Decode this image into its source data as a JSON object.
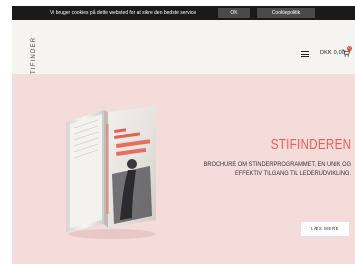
{
  "cookie_bar": {
    "text": "Vi bruger cookies på dette websted for at sikre den bedste service",
    "ok_label": "OK",
    "policy_label": "Cookiepolitik"
  },
  "header": {
    "logo_text": "STIFINDER",
    "cart_amount": "DKK 0,00",
    "cart_count": "0"
  },
  "hero": {
    "title": "STIFINDEREN",
    "description": "BROCHURE OM STINDERPROGRAMMET, EN UNIK OG EFFEKTIV TILGANG TIL LEDERUDVIKLING.",
    "button_label": "LÆS MERE"
  },
  "colors": {
    "accent": "#e8604f",
    "hero_background": "#f4dcdb",
    "page_background": "#f6f4f1",
    "cookie_bar": "#1a1a1a"
  },
  "icons": [
    "menu-icon",
    "cart-icon"
  ]
}
